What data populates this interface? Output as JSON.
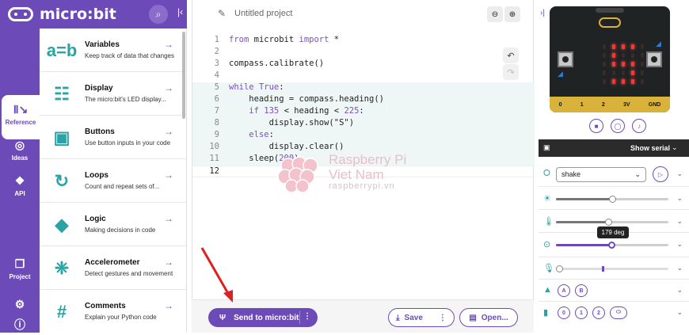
{
  "app": {
    "brand": "micro:bit"
  },
  "rail": {
    "reference": "Reference",
    "ideas": "Ideas",
    "api": "API",
    "project": "Project"
  },
  "reference_items": [
    {
      "title": "Variables",
      "desc": "Keep track of data that changes",
      "icon": "variables-icon"
    },
    {
      "title": "Display",
      "desc": "The micro:bit's LED display...",
      "icon": "display-icon"
    },
    {
      "title": "Buttons",
      "desc": "Use button inputs in your code",
      "icon": "buttons-icon"
    },
    {
      "title": "Loops",
      "desc": "Count and repeat sets of...",
      "icon": "loops-icon"
    },
    {
      "title": "Logic",
      "desc": "Making decisions in code",
      "icon": "logic-icon"
    },
    {
      "title": "Accelerometer",
      "desc": "Detect gestures and movement",
      "icon": "accelerometer-icon"
    },
    {
      "title": "Comments",
      "desc": "Explain your Python code",
      "icon": "comments-icon"
    }
  ],
  "editor": {
    "project_name": "Untitled project",
    "lines": [
      "1",
      "2",
      "3",
      "4",
      "5",
      "6",
      "7",
      "8",
      "9",
      "10",
      "11",
      "12"
    ]
  },
  "watermark": {
    "line1": "Raspberry Pi",
    "line2": "Viet Nam",
    "line3": "raspberrypi.vn"
  },
  "bottom": {
    "send_label": "Send to micro:bit",
    "save_label": "Save",
    "open_label": "Open..."
  },
  "simulator": {
    "pins": [
      "0",
      "1",
      "2",
      "3V",
      "GND"
    ],
    "serial_label": "Show serial",
    "gesture_value": "shake",
    "compass_tooltip": "179 deg",
    "buttons": [
      "A",
      "B"
    ],
    "touch_pins": [
      "0",
      "1",
      "2"
    ],
    "brightness_level": 0.49,
    "temperature_level": 0.46,
    "compass_level": 0.497,
    "accent": "#6c4bb8",
    "led_on": "#ff3535"
  }
}
